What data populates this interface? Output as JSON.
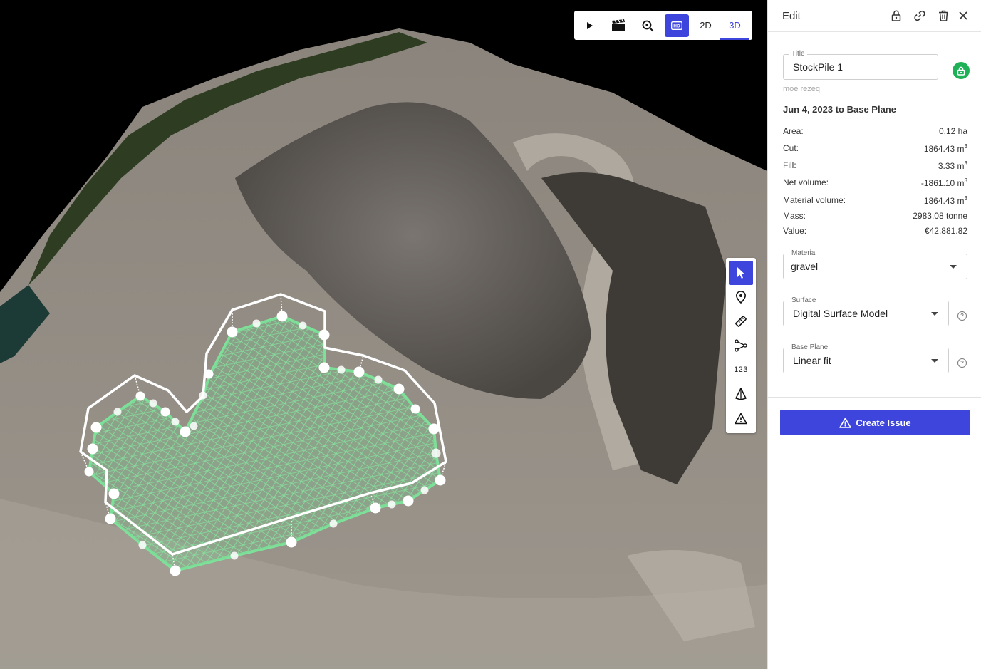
{
  "toolbar": {
    "play": "play-icon",
    "clapper": "clapperboard-icon",
    "zoom_fit": "zoom-fit-icon",
    "hd_label": "HD",
    "mode_2d": "2D",
    "mode_3d": "3D",
    "active_mode": "3D"
  },
  "tools": [
    {
      "name": "select-tool",
      "icon": "cursor-icon",
      "active": true
    },
    {
      "name": "location-tool",
      "icon": "map-pin-icon"
    },
    {
      "name": "measure-tool",
      "icon": "ruler-icon"
    },
    {
      "name": "polyline-tool",
      "icon": "polyline-icon"
    },
    {
      "name": "coordinates-tool",
      "label": "123"
    },
    {
      "name": "volume-tool",
      "icon": "pyramid-icon"
    },
    {
      "name": "issue-tool",
      "icon": "warning-icon"
    }
  ],
  "panel": {
    "title": "Edit",
    "header_icons": [
      "lock-icon",
      "link-icon",
      "trash-icon",
      "close-icon"
    ],
    "title_field": {
      "label": "Title",
      "value": "StockPile 1"
    },
    "author": "moe rezeq",
    "comparison": "Jun 4, 2023 to Base Plane",
    "stats": {
      "area": {
        "label": "Area:",
        "value": "0.12 ha"
      },
      "cut": {
        "label": "Cut:",
        "value": "1864.43 m",
        "sup": "3"
      },
      "fill": {
        "label": "Fill:",
        "value": "3.33 m",
        "sup": "3"
      },
      "net": {
        "label": "Net volume:",
        "value": "-1861.10 m",
        "sup": "3"
      },
      "material_volume": {
        "label": "Material volume:",
        "value": "1864.43 m",
        "sup": "3"
      },
      "mass": {
        "label": "Mass:",
        "value": "2983.08 tonne"
      },
      "value": {
        "label": "Value:",
        "value": "€42,881.82"
      }
    },
    "material": {
      "label": "Material",
      "value": "gravel"
    },
    "surface": {
      "label": "Surface",
      "value": "Digital Surface Model"
    },
    "base_plane": {
      "label": "Base Plane",
      "value": "Linear fit"
    },
    "create_issue": "Create Issue"
  },
  "colors": {
    "accent": "#3d45dc",
    "lock_green": "#1fb157",
    "stockpile_fill": "#7fe09a",
    "outline": "#ffffff"
  }
}
